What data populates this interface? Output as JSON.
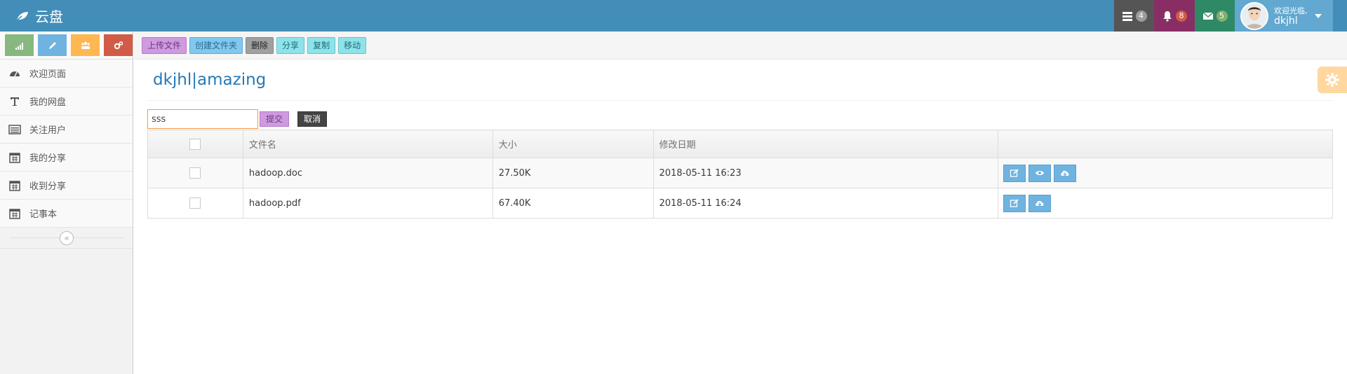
{
  "navbar": {
    "brand": "云盘",
    "tasks_count": "4",
    "notifications_count": "8",
    "messages_count": "5",
    "user_welcome": "欢迎光临,",
    "username": "dkjhl"
  },
  "sidebar": {
    "items": [
      {
        "label": "欢迎页面",
        "icon": "dashboard-icon"
      },
      {
        "label": "我的网盘",
        "icon": "text-icon"
      },
      {
        "label": "关注用户",
        "icon": "list-icon"
      },
      {
        "label": "我的分享",
        "icon": "calendar-icon"
      },
      {
        "label": "收到分享",
        "icon": "calendar-icon"
      },
      {
        "label": "记事本",
        "icon": "calendar-icon"
      }
    ],
    "collapse_glyph": "«"
  },
  "toolbar": {
    "upload": "上传文件",
    "new_folder": "创建文件夹",
    "delete": "删除",
    "share": "分享",
    "copy": "复制",
    "move": "移动"
  },
  "page": {
    "title": "dkjhl|amazing"
  },
  "rename": {
    "value": "sss",
    "submit": "提交",
    "cancel": "取消"
  },
  "table": {
    "headers": {
      "name": "文件名",
      "size": "大小",
      "modified": "修改日期"
    },
    "rows": [
      {
        "name": "hadoop.doc",
        "size": "27.50K",
        "modified": "2018-05-11 16:23"
      },
      {
        "name": "hadoop.pdf",
        "size": "67.40K",
        "modified": "2018-05-11 16:24"
      }
    ]
  },
  "colors": {
    "navbar": "#438eb9",
    "accent_blue": "#6fb3e0",
    "title_blue": "#2679b5"
  }
}
